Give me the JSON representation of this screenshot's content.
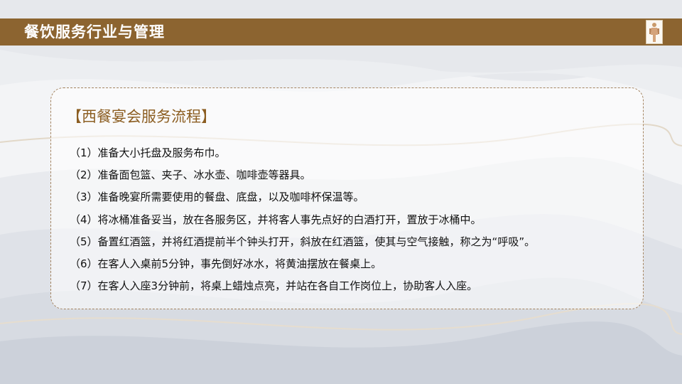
{
  "header": {
    "title": "餐饮服务行业与管理",
    "logo_icon": "figure-logo-icon"
  },
  "section": {
    "title": "【西餐宴会服务流程】",
    "steps": [
      "（1）准备大小托盘及服务布巾。",
      "（2）准备面包篮、夹子、冰水壶、咖啡壶等器具。",
      "（3）准备晚宴所需要使用的餐盘、底盘，以及咖啡杯保温等。",
      "（4）将冰桶准备妥当，放在各服务区，并将客人事先点好的白酒打开，置放于冰桶中。",
      "（5）备置红酒篮，并将红酒提前半个钟头打开，斜放在红酒篮，使其与空气接触，称之为“呼吸”。",
      "（6）在客人入桌前5分钟，事先倒好冰水，将黄油摆放在餐桌上。",
      "（7）在客人入座3分钟前，将桌上蜡烛点亮，并站在各自工作岗位上，协助客人入座。"
    ]
  },
  "colors": {
    "header_bar": "#8c6430",
    "section_title": "#8c5e22",
    "box_border": "#a48461",
    "body_text": "#111111"
  }
}
